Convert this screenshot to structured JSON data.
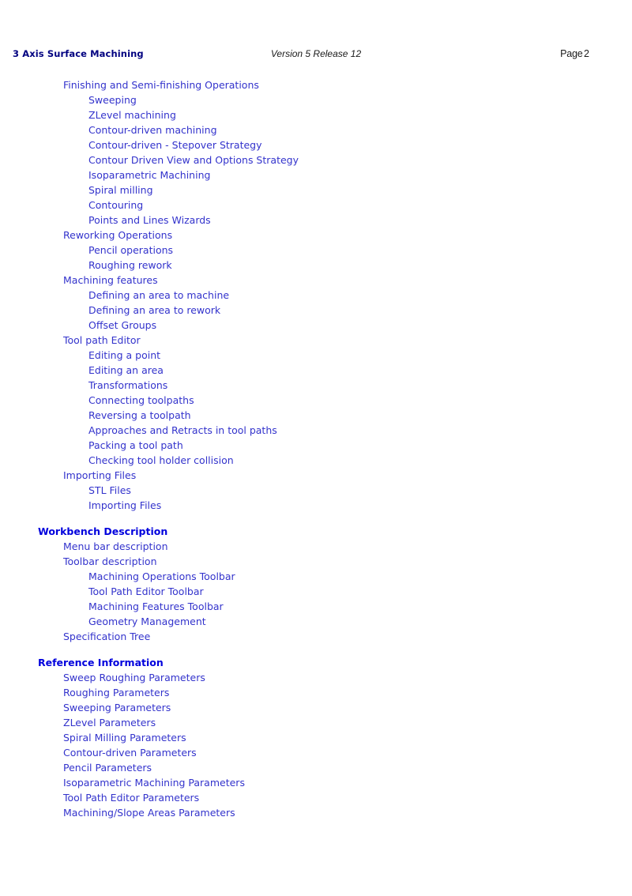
{
  "header": {
    "title": "3 Axis Surface Machining",
    "version": "Version 5 Release 12",
    "page_label": "Page",
    "page_number": "2"
  },
  "colors": {
    "header_title": "#000080",
    "section_heading": "#0000dd",
    "entry": "#3333cc",
    "header_text": "#1a1a1a",
    "background": "#ffffff"
  },
  "toc": {
    "entries": [
      {
        "label": "Finishing and Semi-finishing Operations",
        "level": 1
      },
      {
        "label": "Sweeping",
        "level": 2
      },
      {
        "label": "ZLevel machining",
        "level": 2
      },
      {
        "label": "Contour-driven machining",
        "level": 2
      },
      {
        "label": "Contour-driven - Stepover Strategy",
        "level": 2
      },
      {
        "label": "Contour Driven View and Options Strategy",
        "level": 2
      },
      {
        "label": "Isoparametric Machining",
        "level": 2
      },
      {
        "label": "Spiral milling",
        "level": 2
      },
      {
        "label": "Contouring",
        "level": 2
      },
      {
        "label": "Points and Lines Wizards",
        "level": 2
      },
      {
        "label": "Reworking Operations",
        "level": 1
      },
      {
        "label": "Pencil operations",
        "level": 2
      },
      {
        "label": "Roughing rework",
        "level": 2
      },
      {
        "label": "Machining features",
        "level": 1
      },
      {
        "label": "Defining an area to machine",
        "level": 2
      },
      {
        "label": "Defining an area to rework",
        "level": 2
      },
      {
        "label": "Offset Groups",
        "level": 2
      },
      {
        "label": "Tool path Editor",
        "level": 1
      },
      {
        "label": "Editing a point",
        "level": 2
      },
      {
        "label": "Editing an area",
        "level": 2
      },
      {
        "label": "Transformations",
        "level": 2
      },
      {
        "label": "Connecting toolpaths",
        "level": 2
      },
      {
        "label": "Reversing a toolpath",
        "level": 2
      },
      {
        "label": "Approaches and Retracts in tool paths",
        "level": 2
      },
      {
        "label": "Packing a tool path",
        "level": 2
      },
      {
        "label": "Checking tool holder collision",
        "level": 2
      },
      {
        "label": "Importing Files",
        "level": 1
      },
      {
        "label": "STL Files",
        "level": 2
      },
      {
        "label": "Importing Files",
        "level": 2
      },
      {
        "label": "Workbench Description",
        "level": 0
      },
      {
        "label": "Menu bar description",
        "level": 1
      },
      {
        "label": "Toolbar description",
        "level": 1
      },
      {
        "label": "Machining Operations Toolbar",
        "level": 2
      },
      {
        "label": "Tool Path Editor Toolbar",
        "level": 2
      },
      {
        "label": "Machining Features Toolbar",
        "level": 2
      },
      {
        "label": "Geometry Management",
        "level": 2
      },
      {
        "label": "Specification Tree",
        "level": 1
      },
      {
        "label": "Reference Information",
        "level": 0
      },
      {
        "label": "Sweep Roughing Parameters",
        "level": 1
      },
      {
        "label": "Roughing Parameters",
        "level": 1
      },
      {
        "label": "Sweeping Parameters",
        "level": 1
      },
      {
        "label": "ZLevel Parameters",
        "level": 1
      },
      {
        "label": "Spiral Milling Parameters",
        "level": 1
      },
      {
        "label": "Contour-driven Parameters",
        "level": 1
      },
      {
        "label": "Pencil Parameters",
        "level": 1
      },
      {
        "label": "Isoparametric Machining Parameters",
        "level": 1
      },
      {
        "label": "Tool Path Editor Parameters",
        "level": 1
      },
      {
        "label": "Machining/Slope Areas Parameters",
        "level": 1
      }
    ]
  }
}
